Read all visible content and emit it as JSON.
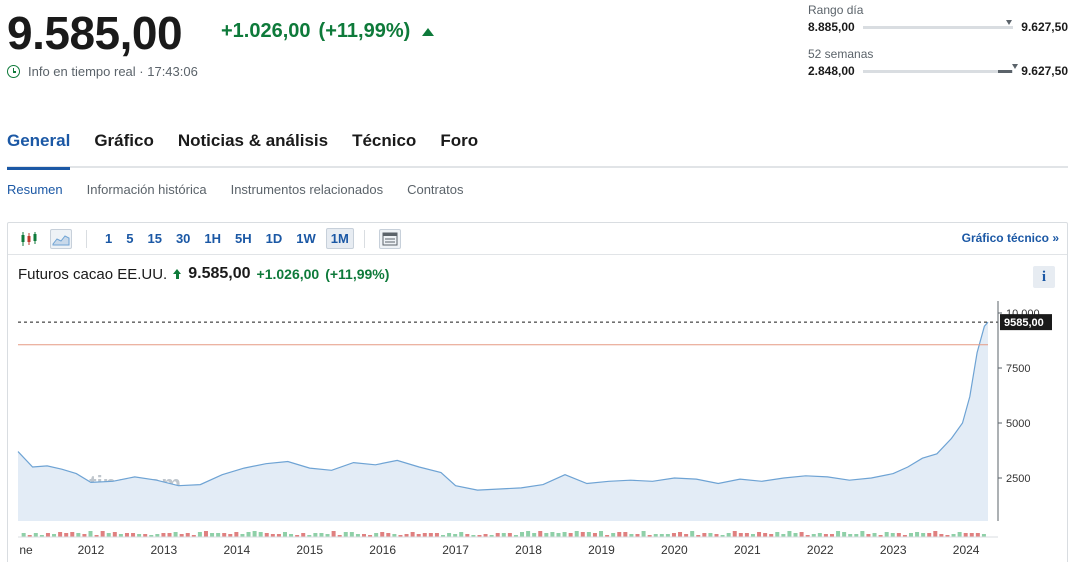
{
  "header": {
    "price": "9.585,00",
    "change": "+1.026,00",
    "change_pct": "(+11,99%)",
    "realtime_label": "Info en tiempo real · 17:43:06"
  },
  "ranges": {
    "day": {
      "label": "Rango día",
      "low": "8.885,00",
      "high": "9.627,50",
      "position": 0.95
    },
    "weeks52": {
      "label": "52 semanas",
      "low": "2.848,00",
      "high": "9.627,50",
      "position": 0.99
    }
  },
  "main_tabs": [
    "General",
    "Gráfico",
    "Noticias & análisis",
    "Técnico",
    "Foro"
  ],
  "sub_tabs": [
    "Resumen",
    "Información histórica",
    "Instrumentos relacionados",
    "Contratos"
  ],
  "toolbar": {
    "intervals": [
      "1",
      "5",
      "15",
      "30",
      "1H",
      "5H",
      "1D",
      "1W",
      "1M"
    ],
    "active_interval": "1M",
    "tech_link": "Gráfico técnico »"
  },
  "chart_title": {
    "name": "Futuros cacao EE.UU.",
    "price": "9.585,00",
    "change": "+1.026,00",
    "change_pct": "(+11,99%)"
  },
  "info_label": "i",
  "colors": {
    "green": "#0e7a3a",
    "blue": "#1b58a5",
    "line": "#6ea3d4",
    "area": "#e3ecf6",
    "ref_line": "#e59a83"
  },
  "chart_data": {
    "type": "area",
    "title": "Futuros cacao EE.UU.",
    "x_labels": [
      "ne",
      "2012",
      "2013",
      "2014",
      "2015",
      "2016",
      "2017",
      "2018",
      "2019",
      "2020",
      "2021",
      "2022",
      "2023",
      "2024"
    ],
    "y_ticks": [
      "10.000",
      "7500",
      "5000",
      "2500"
    ],
    "ylim": [
      0,
      10000
    ],
    "last_value_label": "9585,00",
    "last_value": 9585,
    "reference_value": 8559,
    "watermark": "Investing.com",
    "series": [
      {
        "x": [
          2011.0,
          2011.2,
          2011.4,
          2011.6,
          2011.8,
          2012.0,
          2012.3,
          2012.6,
          2012.9,
          2013.2,
          2013.5,
          2013.8,
          2014.1,
          2014.4,
          2014.7,
          2015.0,
          2015.3,
          2015.6,
          2015.9,
          2016.2,
          2016.5,
          2016.8,
          2017.0,
          2017.3,
          2017.6,
          2017.9,
          2018.2,
          2018.5,
          2018.8,
          2019.1,
          2019.4,
          2019.7,
          2020.0,
          2020.3,
          2020.6,
          2020.9,
          2021.2,
          2021.5,
          2021.8,
          2022.1,
          2022.4,
          2022.7,
          2023.0,
          2023.2,
          2023.4,
          2023.6,
          2023.8,
          2023.95,
          2024.05,
          2024.15,
          2024.25,
          2024.3
        ],
        "values": [
          3700,
          3000,
          3050,
          2900,
          2700,
          2300,
          2350,
          2550,
          2400,
          2150,
          2200,
          2650,
          2950,
          3150,
          3250,
          2950,
          2850,
          3200,
          3100,
          3300,
          3000,
          2750,
          2150,
          1950,
          2000,
          2050,
          2200,
          2650,
          2250,
          2350,
          2400,
          2350,
          2500,
          2450,
          2250,
          2450,
          2350,
          2500,
          2600,
          2550,
          2400,
          2500,
          2700,
          3000,
          3400,
          3600,
          4300,
          5000,
          6200,
          8200,
          9400,
          9585
        ]
      }
    ],
    "volume_note": "monthly volume bars (red/green) along bottom"
  }
}
